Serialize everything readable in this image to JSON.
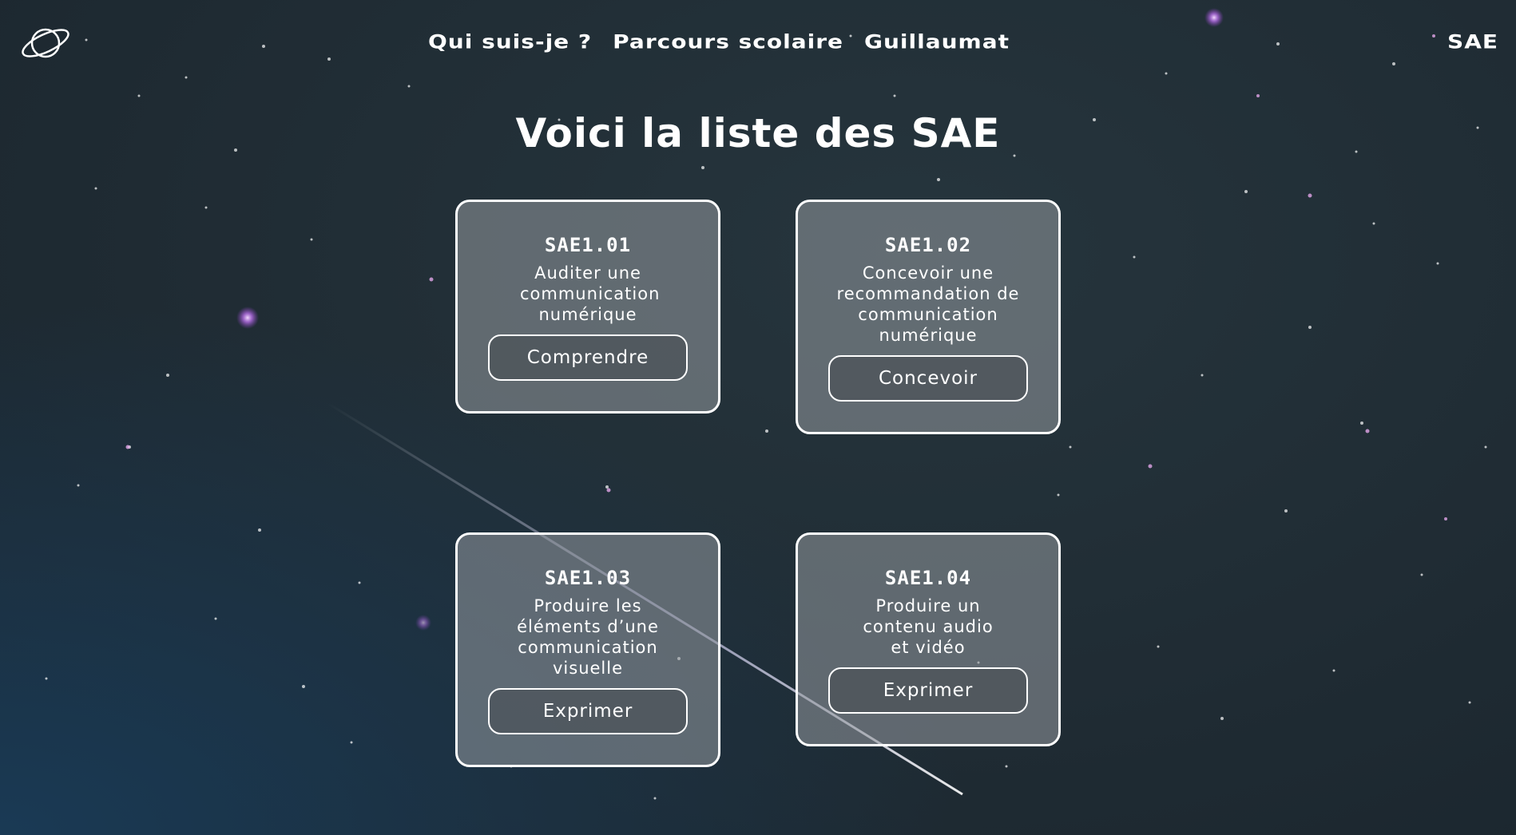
{
  "nav": {
    "links": [
      "Qui suis-je ?",
      "Parcours scolaire",
      "Guillaumat"
    ],
    "right_link": "SAE"
  },
  "title": "Voici la liste des SAE",
  "cards": [
    {
      "code": "SAE1.01",
      "description": "Auditer une communication numérique",
      "button": "Comprendre"
    },
    {
      "code": "SAE1.02",
      "description": "Concevoir une recommandation de communication numérique",
      "button": "Concevoir"
    },
    {
      "code": "SAE1.03",
      "description": "Produire les éléments d’une communication visuelle",
      "button": "Exprimer"
    },
    {
      "code": "SAE1.04",
      "description": "Produire un contenu audio et vidéo",
      "button": "Exprimer"
    }
  ],
  "icons": {
    "logo": "planet-icon"
  },
  "colors": {
    "text": "#ffffff",
    "card_border": "#ffffff"
  }
}
